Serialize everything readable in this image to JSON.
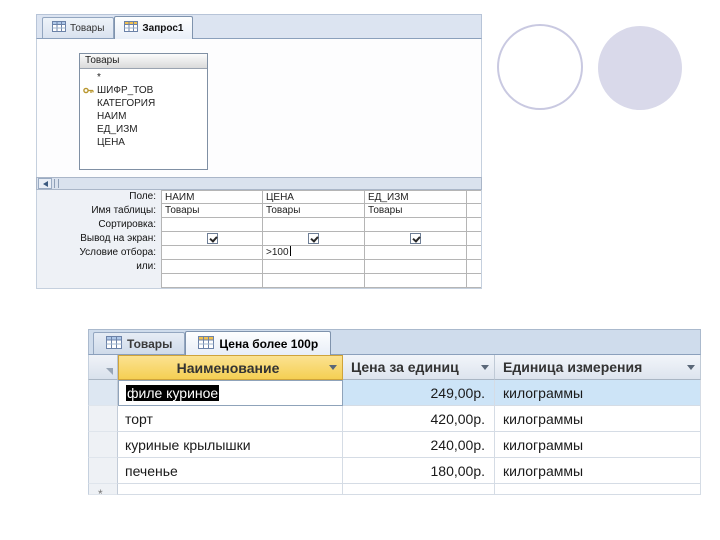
{
  "colors": {
    "tab_strip_background": "#dce4f1",
    "selected_column_header": "#f5cf53",
    "selected_row_background": "#cde4f7",
    "selection_highlight": "#000000",
    "outline_circle_border": "#c9c9e1",
    "filled_circle_fill": "#d9d9ea"
  },
  "designer": {
    "tabs": [
      {
        "label": "Товары",
        "icon": "table-icon",
        "active": false
      },
      {
        "label": "Запрос1",
        "icon": "query-icon",
        "active": true
      }
    ],
    "field_list": {
      "title": "Товары",
      "fields": [
        {
          "name": "*",
          "key": false
        },
        {
          "name": "ШИФР_ТОВ",
          "key": true
        },
        {
          "name": "КАТЕГОРИЯ",
          "key": false
        },
        {
          "name": "НАИМ",
          "key": false
        },
        {
          "name": "ЕД_ИЗМ",
          "key": false
        },
        {
          "name": "ЦЕНА",
          "key": false
        }
      ]
    },
    "grid": {
      "row_labels": [
        "Поле:",
        "Имя таблицы:",
        "Сортировка:",
        "Вывод на экран:",
        "Условие отбора:",
        "или:"
      ],
      "columns": [
        {
          "field": "НАИМ",
          "table": "Товары",
          "sort": "",
          "show": true,
          "criteria": "",
          "or": ""
        },
        {
          "field": "ЦЕНА",
          "table": "Товары",
          "sort": "",
          "show": true,
          "criteria": ">100",
          "or": ""
        },
        {
          "field": "ЕД_ИЗМ",
          "table": "Товары",
          "sort": "",
          "show": true,
          "criteria": "",
          "or": ""
        }
      ]
    }
  },
  "datasheet": {
    "tabs": [
      {
        "label": "Товары",
        "icon": "table-icon",
        "active": false
      },
      {
        "label": "Цена более 100р",
        "icon": "query-icon",
        "active": true
      }
    ],
    "columns": [
      {
        "label": "Наименование",
        "selected": true
      },
      {
        "label": "Цена за единиц",
        "selected": false
      },
      {
        "label": "Единица измерения",
        "selected": false
      }
    ],
    "rows": [
      {
        "name": "филе куриное",
        "price": "249,00р.",
        "unit": "килограммы",
        "selected": true
      },
      {
        "name": "торт",
        "price": "420,00р.",
        "unit": "килограммы",
        "selected": false
      },
      {
        "name": "куриные крылышки",
        "price": "240,00р.",
        "unit": "килограммы",
        "selected": false
      },
      {
        "name": "печенье",
        "price": "180,00р.",
        "unit": "килограммы",
        "selected": false
      }
    ],
    "new_record_marker": "*"
  }
}
